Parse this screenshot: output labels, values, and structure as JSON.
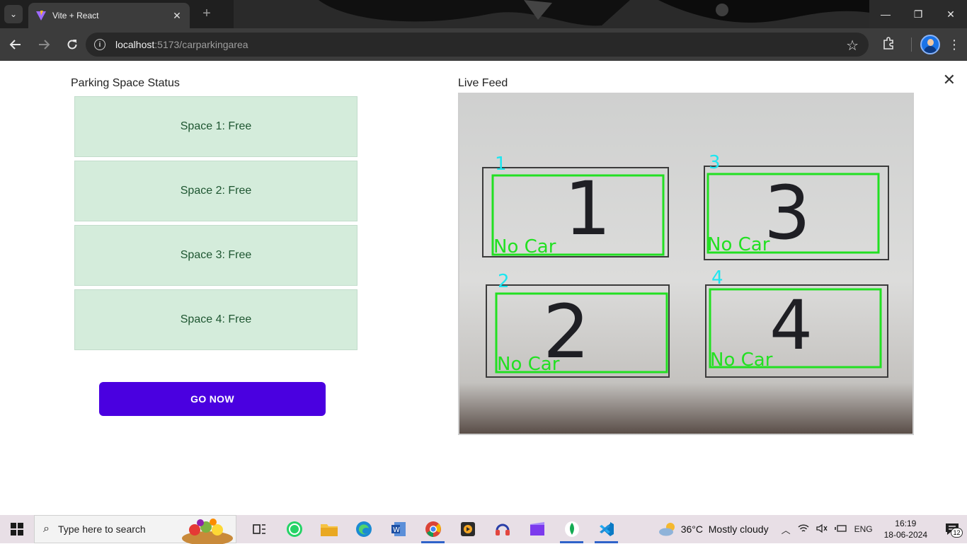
{
  "browser": {
    "tab_title": "Vite + React",
    "url_host": "localhost",
    "url_path": ":5173/carparkingarea",
    "window_controls": {
      "minimize": "—",
      "restore": "❐",
      "close": "✕"
    }
  },
  "page": {
    "status_heading": "Parking Space Status",
    "spaces": [
      {
        "label": "Space 1: Free"
      },
      {
        "label": "Space 2: Free"
      },
      {
        "label": "Space 3: Free"
      },
      {
        "label": "Space 4: Free"
      }
    ],
    "go_button": "GO NOW",
    "feed_heading": "Live Feed",
    "close_label": "✕",
    "feed": {
      "slots": [
        {
          "id": "1",
          "digit": "1",
          "status": "No Car"
        },
        {
          "id": "3",
          "digit": "3",
          "status": "No Car"
        },
        {
          "id": "2",
          "digit": "2",
          "status": "No Car"
        },
        {
          "id": "4",
          "digit": "4",
          "status": "No Car"
        }
      ],
      "box_color": "#22e022",
      "label_color": "#1ee6f0"
    }
  },
  "taskbar": {
    "search_placeholder": "Type here to search",
    "weather_temp": "36°C",
    "weather_desc": "Mostly cloudy",
    "language": "ENG",
    "time": "16:19",
    "date": "18-06-2024",
    "notification_count": "12"
  },
  "colors": {
    "free_bg": "#d4ecdb",
    "free_text": "#1e5631",
    "go_button_bg": "#4a00e0"
  }
}
